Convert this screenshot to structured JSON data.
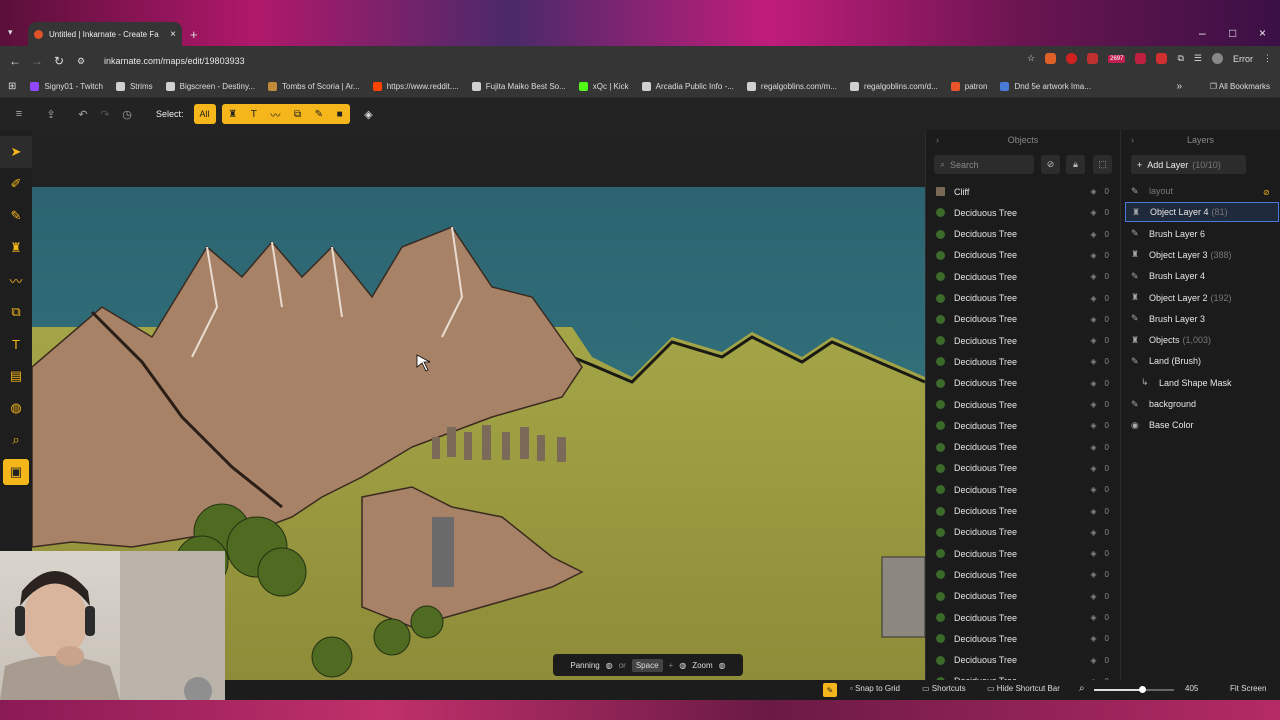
{
  "browser": {
    "tab_title": "Untitled | Inkarnate - Create Fa",
    "url": "inkarnate.com/maps/edit/19803933",
    "bookmarks": [
      {
        "label": "Signy01 - Twitch",
        "color": "#9146ff"
      },
      {
        "label": "Strims",
        "color": "#d0d0d0"
      },
      {
        "label": "Bigscreen - Destiny...",
        "color": "#d0d0d0"
      },
      {
        "label": "Tombs of Scoria | Ar...",
        "color": "#c08a3a"
      },
      {
        "label": "https://www.reddit....",
        "color": "#ff4500"
      },
      {
        "label": "Fujita Maiko Best So...",
        "color": "#d0d0d0"
      },
      {
        "label": "xQc | Kick",
        "color": "#53fc18"
      },
      {
        "label": "Arcadia Public Info -...",
        "color": "#d0d0d0"
      },
      {
        "label": "regalgoblins.com/m...",
        "color": "#d0d0d0"
      },
      {
        "label": "regalgoblins.com/d...",
        "color": "#d0d0d0"
      },
      {
        "label": "patron",
        "color": "#e8552a"
      },
      {
        "label": "Dnd 5e artwork Ima...",
        "color": "#4a7ad8"
      }
    ],
    "all_bookmarks": "All Bookmarks",
    "error_label": "Error",
    "badge_count": "2697"
  },
  "toolbar": {
    "select_label": "Select:",
    "all_label": "All"
  },
  "objects_panel": {
    "title": "Objects",
    "search_placeholder": "Search",
    "items": [
      {
        "name": "Cliff",
        "count": "0"
      },
      {
        "name": "Deciduous Tree",
        "count": "0"
      },
      {
        "name": "Deciduous Tree",
        "count": "0"
      },
      {
        "name": "Deciduous Tree",
        "count": "0"
      },
      {
        "name": "Deciduous Tree",
        "count": "0"
      },
      {
        "name": "Deciduous Tree",
        "count": "0"
      },
      {
        "name": "Deciduous Tree",
        "count": "0"
      },
      {
        "name": "Deciduous Tree",
        "count": "0"
      },
      {
        "name": "Deciduous Tree",
        "count": "0"
      },
      {
        "name": "Deciduous Tree",
        "count": "0"
      },
      {
        "name": "Deciduous Tree",
        "count": "0"
      },
      {
        "name": "Deciduous Tree",
        "count": "0"
      },
      {
        "name": "Deciduous Tree",
        "count": "0"
      },
      {
        "name": "Deciduous Tree",
        "count": "0"
      },
      {
        "name": "Deciduous Tree",
        "count": "0"
      },
      {
        "name": "Deciduous Tree",
        "count": "0"
      },
      {
        "name": "Deciduous Tree",
        "count": "0"
      },
      {
        "name": "Deciduous Tree",
        "count": "0"
      },
      {
        "name": "Deciduous Tree",
        "count": "0"
      },
      {
        "name": "Deciduous Tree",
        "count": "0"
      },
      {
        "name": "Deciduous Tree",
        "count": "0"
      },
      {
        "name": "Deciduous Tree",
        "count": "0"
      },
      {
        "name": "Deciduous Tree",
        "count": "0"
      },
      {
        "name": "Deciduous Tree",
        "count": "0"
      }
    ]
  },
  "layers_panel": {
    "title": "Layers",
    "add_label": "Add Layer",
    "add_count": "(10/10)",
    "items": [
      {
        "name": "layout",
        "count": "",
        "icon": "brush-icon"
      },
      {
        "name": "Object Layer 4",
        "count": "(81)",
        "icon": "object-icon"
      },
      {
        "name": "Brush Layer 6",
        "count": "",
        "icon": "brush-icon"
      },
      {
        "name": "Object Layer 3",
        "count": "(388)",
        "icon": "object-icon"
      },
      {
        "name": "Brush Layer 4",
        "count": "",
        "icon": "brush-icon"
      },
      {
        "name": "Object Layer 2",
        "count": "(192)",
        "icon": "object-icon"
      },
      {
        "name": "Brush Layer 3",
        "count": "",
        "icon": "brush-icon"
      },
      {
        "name": "Objects",
        "count": "(1,003)",
        "icon": "object-icon"
      },
      {
        "name": "Land (Brush)",
        "count": "",
        "icon": "brush-icon"
      },
      {
        "name": "Land Shape Mask",
        "count": "",
        "icon": "mask-icon"
      },
      {
        "name": "background",
        "count": "",
        "icon": "brush-icon"
      },
      {
        "name": "Base Color",
        "count": "",
        "icon": "palette-icon"
      }
    ]
  },
  "hint": {
    "panning": "Panning",
    "or": "or",
    "space": "Space",
    "plus": "+",
    "zoom": "Zoom"
  },
  "bottom": {
    "snap": "Snap to Grid",
    "shortcuts": "Shortcuts",
    "hide": "Hide Shortcut Bar",
    "zoom_value": "405",
    "fit": "Fit Screen",
    "zoom_level": 0.6
  },
  "colors": {
    "accent": "#f4b61a",
    "water": "#2f6c76",
    "land": "#9a9a3a",
    "selection": "#4a7ad8"
  }
}
